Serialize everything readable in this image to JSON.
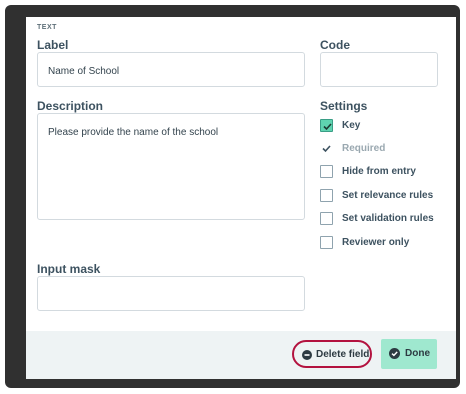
{
  "field": {
    "type": "TEXT",
    "label_heading": "Label",
    "label_value": "Name of School",
    "code_heading": "Code",
    "code_value": "",
    "description_heading": "Description",
    "description_value": "Please provide the name of the school",
    "input_mask_heading": "Input mask",
    "input_mask_value": ""
  },
  "settings": {
    "heading": "Settings",
    "items": [
      {
        "label": "Key",
        "checked": true,
        "disabled": false
      },
      {
        "label": "Required",
        "checked": true,
        "disabled": true
      },
      {
        "label": "Hide from entry",
        "checked": false,
        "disabled": false
      },
      {
        "label": "Set relevance rules",
        "checked": false,
        "disabled": false
      },
      {
        "label": "Set validation rules",
        "checked": false,
        "disabled": false
      },
      {
        "label": "Reviewer only",
        "checked": false,
        "disabled": false
      }
    ]
  },
  "footer": {
    "delete_label": "Delete field",
    "done_label": "Done"
  },
  "colors": {
    "accent": "#5fd3b0",
    "done_bg": "#9fe8cf",
    "delete_outline": "#b3123f"
  }
}
